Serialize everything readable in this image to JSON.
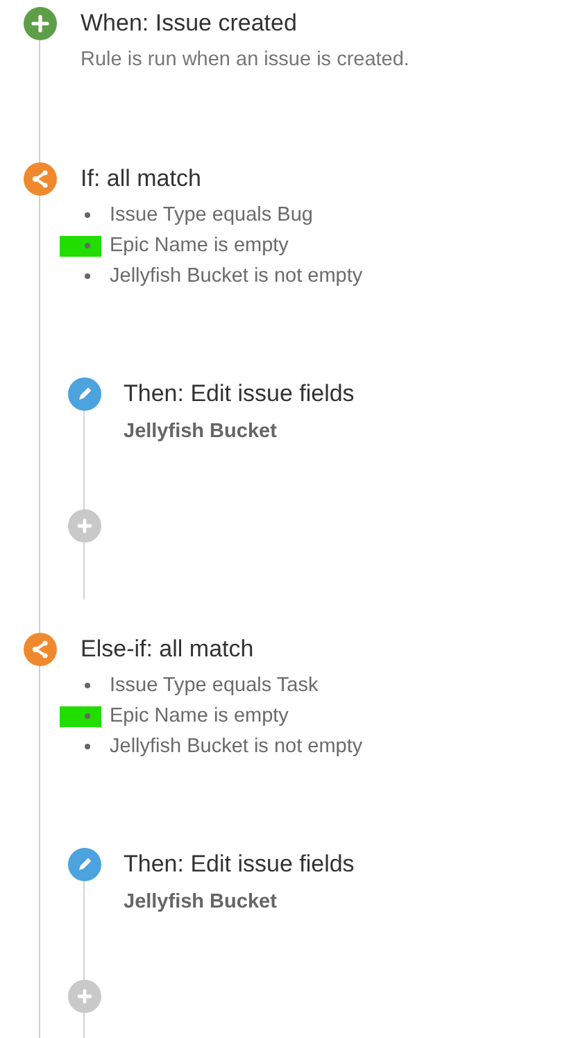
{
  "steps": [
    {
      "kind": "trigger",
      "title": "When: Issue created",
      "description": "Rule is run when an issue is created."
    },
    {
      "kind": "condition",
      "title": "If: all match",
      "conditions": [
        {
          "text": "Issue Type equals Bug",
          "highlighted": false
        },
        {
          "text": "Epic Name is empty",
          "highlighted": true
        },
        {
          "text": "Jellyfish Bucket is not empty",
          "highlighted": false
        }
      ],
      "branch": [
        {
          "kind": "action",
          "title": "Then: Edit issue fields",
          "detail": "Jellyfish Bucket"
        },
        {
          "kind": "add"
        }
      ]
    },
    {
      "kind": "condition",
      "title": "Else-if: all match",
      "conditions": [
        {
          "text": "Issue Type equals Task",
          "highlighted": false
        },
        {
          "text": "Epic Name is empty",
          "highlighted": true
        },
        {
          "text": "Jellyfish Bucket is not empty",
          "highlighted": false
        }
      ],
      "branch": [
        {
          "kind": "action",
          "title": "Then: Edit issue fields",
          "detail": "Jellyfish Bucket"
        },
        {
          "kind": "add"
        }
      ]
    }
  ]
}
